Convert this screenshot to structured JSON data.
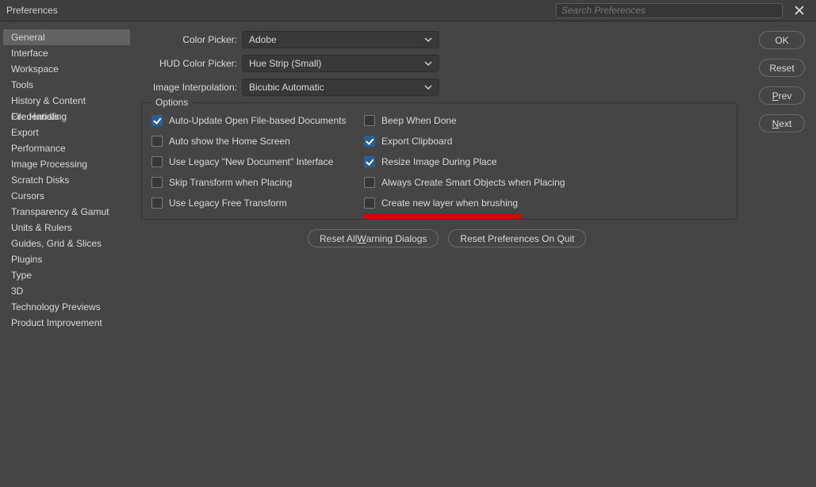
{
  "window": {
    "title": "Preferences"
  },
  "search": {
    "placeholder": "Search Preferences"
  },
  "sidebar": {
    "items": [
      {
        "label": "General",
        "selected": true
      },
      {
        "label": "Interface"
      },
      {
        "label": "Workspace"
      },
      {
        "label": "Tools"
      },
      {
        "label": "History & Content Credentials"
      },
      {
        "label": "File Handling"
      },
      {
        "label": "Export"
      },
      {
        "label": "Performance"
      },
      {
        "label": "Image Processing"
      },
      {
        "label": "Scratch Disks"
      },
      {
        "label": "Cursors"
      },
      {
        "label": "Transparency & Gamut"
      },
      {
        "label": "Units & Rulers"
      },
      {
        "label": "Guides, Grid & Slices"
      },
      {
        "label": "Plugins"
      },
      {
        "label": "Type"
      },
      {
        "label": "3D"
      },
      {
        "label": "Technology Previews"
      },
      {
        "label": "Product Improvement"
      }
    ]
  },
  "form": {
    "color_picker": {
      "label": "Color Picker:",
      "value": "Adobe"
    },
    "hud_color_picker": {
      "label": "HUD Color Picker:",
      "value": "Hue Strip (Small)"
    },
    "image_interpolation": {
      "label": "Image Interpolation:",
      "value": "Bicubic Automatic"
    }
  },
  "options": {
    "legend": "Options",
    "left": [
      {
        "label": "Auto-Update Open File-based Documents",
        "checked": true
      },
      {
        "label": "Auto show the Home Screen",
        "checked": false
      },
      {
        "label": "Use Legacy \"New Document\" Interface",
        "checked": false
      },
      {
        "label": "Skip Transform when Placing",
        "checked": false
      },
      {
        "label": "Use Legacy Free Transform",
        "checked": false
      }
    ],
    "right": [
      {
        "label": "Beep When Done",
        "checked": false
      },
      {
        "label": "Export Clipboard",
        "checked": true
      },
      {
        "label": "Resize Image During Place",
        "checked": true
      },
      {
        "label": "Always Create Smart Objects when Placing",
        "checked": false
      },
      {
        "label": "Create new layer when brushing",
        "checked": false
      }
    ]
  },
  "buttons": {
    "reset_dialogs": "Reset All Warning Dialogs",
    "reset_prefs": "Reset Preferences On Quit",
    "ok": "OK",
    "cancel": "Reset",
    "prev": "Prev",
    "next": "Next"
  }
}
